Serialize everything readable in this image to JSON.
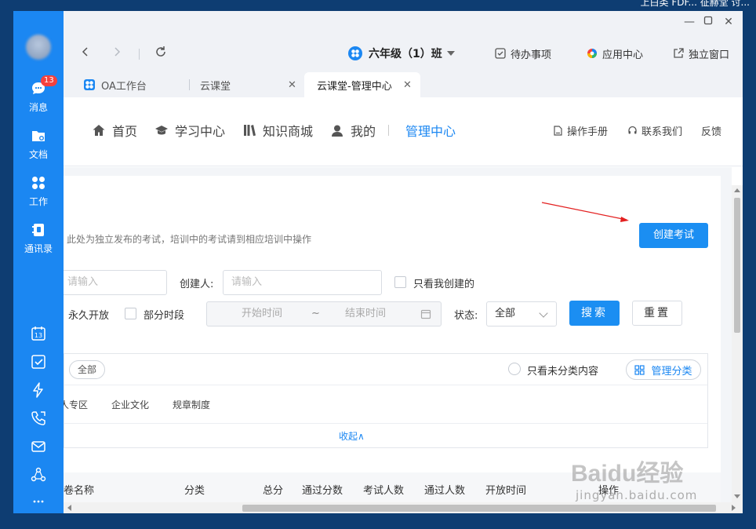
{
  "desktop": {
    "top_right_text": "上白类 FDF... 征赫堂 讨..."
  },
  "sidebar": {
    "items": [
      {
        "label": "消息",
        "badge": "13",
        "icon": "message-icon"
      },
      {
        "label": "文档",
        "icon": "folder-icon"
      },
      {
        "label": "工作",
        "icon": "apps-icon"
      },
      {
        "label": "通讯录",
        "icon": "contacts-icon"
      }
    ],
    "calendar_day": "13"
  },
  "navbar": {
    "class_name": "六年级（1）班",
    "todo": "待办事项",
    "app_center": "应用中心",
    "standalone": "独立窗口"
  },
  "tabs": [
    {
      "label": "OA工作台"
    },
    {
      "label": "云课堂"
    },
    {
      "label": "云课堂-管理中心"
    }
  ],
  "site_nav": {
    "home": "首页",
    "learning": "学习中心",
    "knowledge": "知识商城",
    "mine": "我的",
    "admin": "管理中心",
    "manual": "操作手册",
    "contact": "联系我们",
    "feedback": "反馈"
  },
  "exam": {
    "hint": "此处为独立发布的考试，培训中的考试请到相应培训中操作",
    "create_button": "创建考试",
    "name_placeholder": "请输入",
    "creator_label": "创建人:",
    "creator_placeholder": "请输入",
    "only_mine": "只看我创建的",
    "permanent": "永久开放",
    "partial": "部分时段",
    "start_placeholder": "开始时间",
    "tilde": "~",
    "end_placeholder": "结束时间",
    "status_label": "状态:",
    "status_value": "全部",
    "search": "搜索",
    "reset": "重置"
  },
  "categories": {
    "all": "全部",
    "only_uncat": "只看未分类内容",
    "manage": "管理分类",
    "items": [
      "人专区",
      "企业文化",
      "规章制度"
    ],
    "collapse": "收起∧"
  },
  "table": {
    "columns": [
      "卷名称",
      "分类",
      "总分",
      "通过分数",
      "考试人数",
      "通过人数",
      "开放时间",
      "操作"
    ]
  },
  "watermark": {
    "logo": "Baidu经验",
    "url": "jingyan.baidu.com"
  },
  "colors": {
    "primary": "#1b87f2",
    "sidebar": "#1b87f2",
    "badge": "#f5413d"
  }
}
